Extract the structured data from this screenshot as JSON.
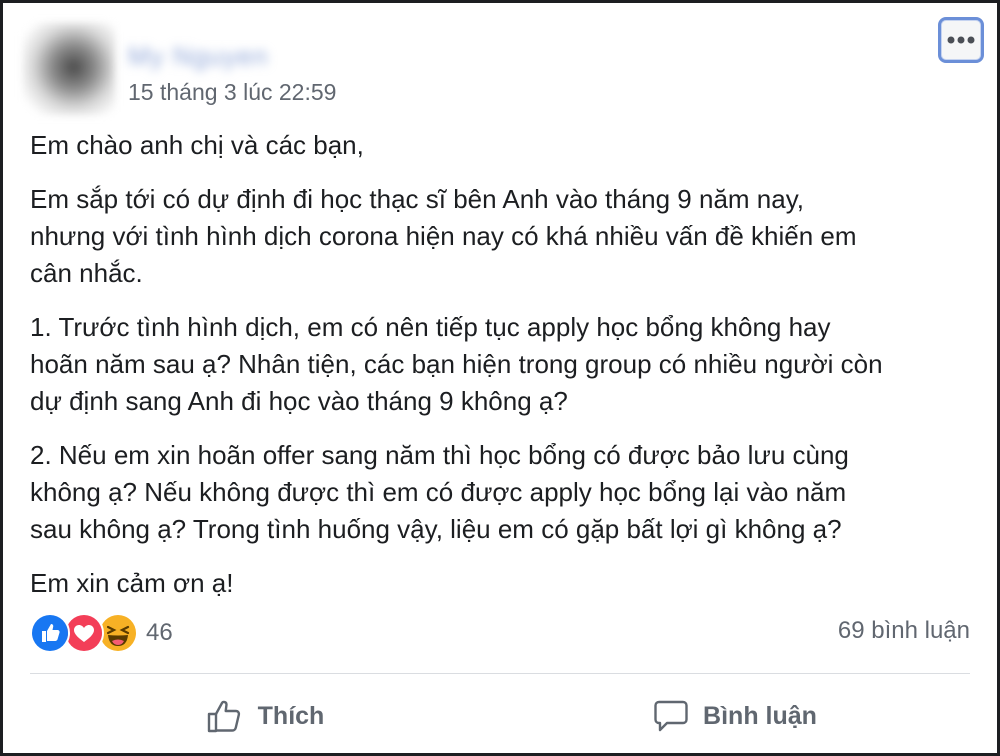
{
  "post": {
    "author_name": "My Nguyen",
    "timestamp": "15 tháng 3 lúc 22:59",
    "more_icon": "more-options-icon",
    "paragraphs": [
      "Em chào anh chị và các bạn,",
      "Em sắp tới có dự định đi học thạc sĩ bên Anh vào tháng 9 năm nay,\nnhưng với tình hình dịch corona hiện nay có khá nhiều vấn đề khiến em\ncân nhắc.",
      "1. Trước tình hình dịch, em có nên tiếp tục apply học bổng không hay\nhoãn năm sau ạ? Nhân tiện, các bạn hiện trong group có nhiều người còn\ndự định sang Anh đi học vào tháng 9 không ạ?",
      "2. Nếu em xin hoãn offer sang năm thì học bổng có được bảo lưu cùng\nkhông ạ? Nếu không được thì em có được apply học bổng lại vào năm\nsau không ạ? Trong tình huống vậy, liệu em có gặp bất lợi gì không ạ?",
      "Em xin cảm ơn ạ!"
    ]
  },
  "stats": {
    "reactions": [
      "like-reaction-icon",
      "love-reaction-icon",
      "haha-reaction-icon"
    ],
    "reaction_count": "46",
    "comment_count": "69 bình luận"
  },
  "actions": {
    "like_label": "Thích",
    "like_icon": "thumbs-up-icon",
    "comment_label": "Bình luận",
    "comment_icon": "comment-bubble-icon"
  },
  "colors": {
    "like_blue": "#1877f2",
    "love_red": "#f33e58",
    "haha_yellow": "#f7b125",
    "secondary_text": "#616770",
    "primary_text": "#1c1e21"
  }
}
